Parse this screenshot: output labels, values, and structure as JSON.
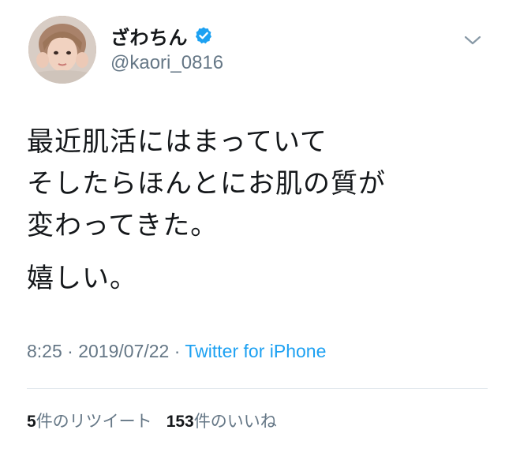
{
  "user": {
    "display_name": "ざわちん",
    "handle": "@kaori_0816",
    "verified": true,
    "verified_color": "#1da1f2"
  },
  "tweet": {
    "lines": [
      "最近肌活にはまっていて",
      "そしたらほんとにお肌の質が",
      "変わってきた。"
    ],
    "line_second_paragraph": "嬉しい。",
    "time": "8:25",
    "date": "2019/07/22",
    "separator": "·",
    "source": "Twitter for iPhone",
    "source_color": "#1da1f2"
  },
  "stats": {
    "retweets_count": "5",
    "retweets_label": "件のリツイート",
    "likes_count": "153",
    "likes_label": "件のいいね"
  },
  "icons": {
    "verified": "verified-badge-icon",
    "caret": "chevron-down-icon"
  }
}
